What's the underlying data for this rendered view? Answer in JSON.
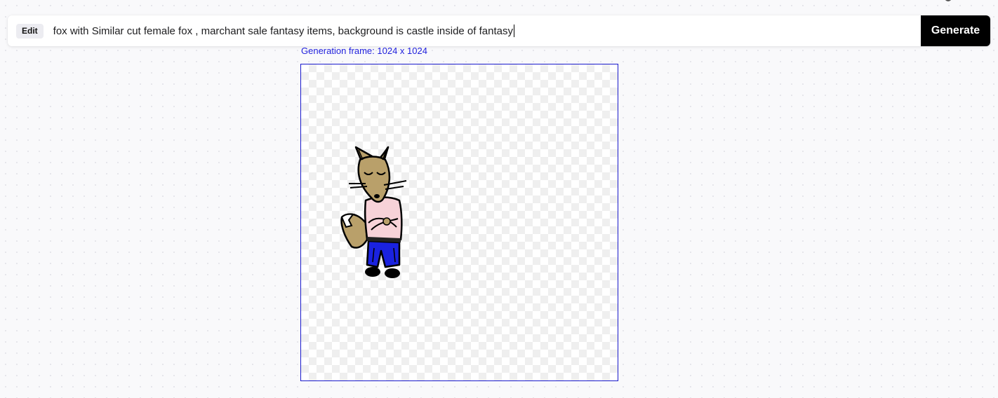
{
  "prompt_bar": {
    "mode_label": "Edit",
    "prompt_text": "fox with Similar cut female fox , marchant sale fantasy items, background is castle inside of fantasy",
    "generate_label": "Generate"
  },
  "canvas": {
    "frame_label": "Generation frame: 1024 x 1024"
  },
  "colors": {
    "accent_blue": "#1a1acc",
    "button_black": "#000000",
    "fox_fur": "#b9a06a",
    "shirt_pink": "#f7d2d8",
    "pants_blue": "#1a22e0"
  },
  "icons": {
    "character": "fox-character-drawing"
  }
}
